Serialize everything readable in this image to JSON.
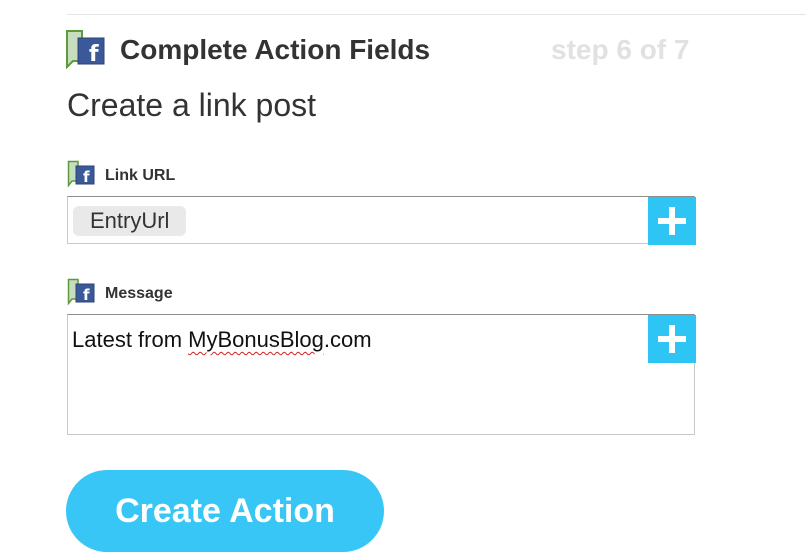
{
  "header": {
    "title": "Complete Action Fields",
    "step": "step 6 of 7",
    "icon": "facebook-icon"
  },
  "subtitle": "Create a link post",
  "fields": {
    "link_url": {
      "label": "Link URL",
      "icon": "facebook-icon",
      "token": "EntryUrl",
      "add_icon": "plus-icon"
    },
    "message": {
      "label": "Message",
      "icon": "facebook-icon",
      "text_before": "Latest from ",
      "text_misspelled": "MyBonusBlog",
      "text_after": ".com",
      "add_icon": "plus-icon"
    }
  },
  "actions": {
    "create_label": "Create Action"
  },
  "colors": {
    "accent": "#37c6f5",
    "plus_button": "#2ec4f4",
    "facebook_blue": "#3b5998",
    "icon_green": "#5c9a3c",
    "step_text": "#e1e1e1",
    "spellcheck": "#d22020"
  }
}
